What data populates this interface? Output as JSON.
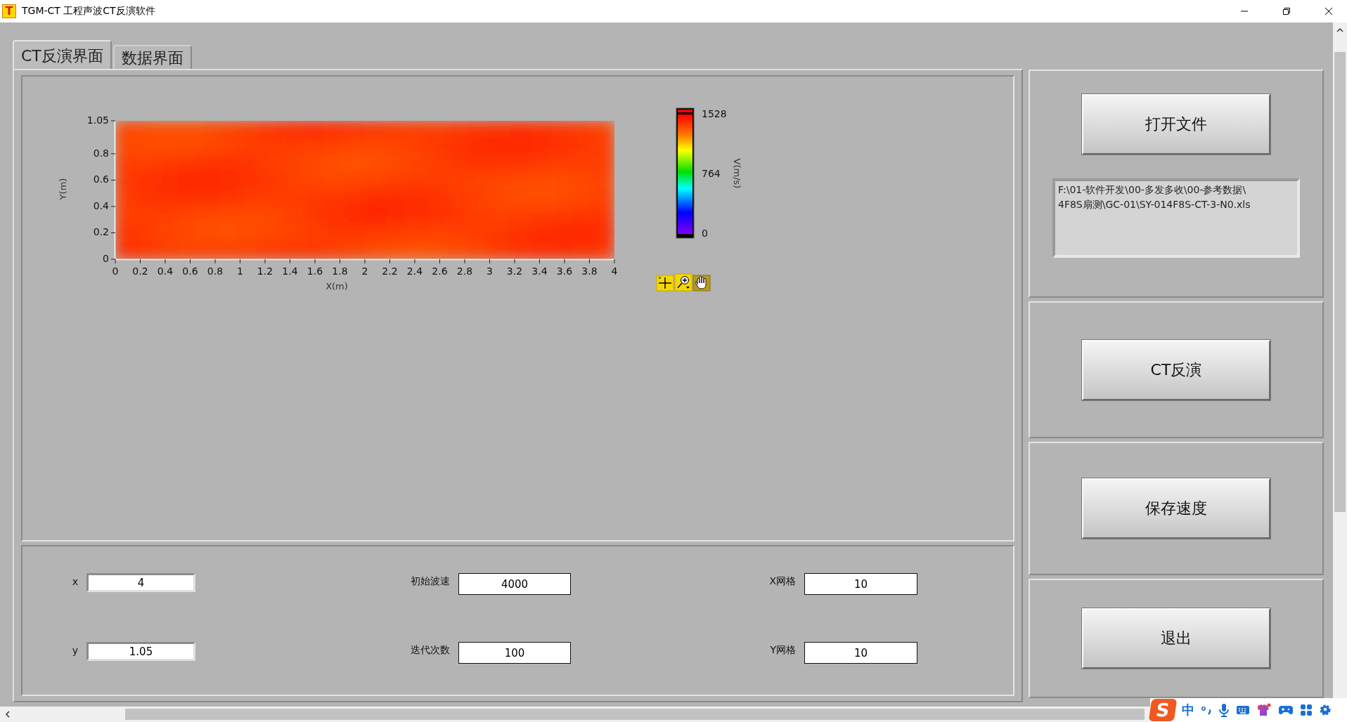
{
  "window": {
    "icon_letter": "T",
    "title": "TGM-CT 工程声波CT反演软件"
  },
  "tabs": [
    {
      "label": "CT反演界面",
      "selected": true
    },
    {
      "label": "数据界面",
      "selected": false
    }
  ],
  "plot": {
    "y_axis_label": "Y(m)",
    "x_axis_label": "X(m)",
    "y_ticks": [
      "1.05",
      "0.8",
      "0.6",
      "0.4",
      "0.2",
      "0"
    ],
    "x_ticks": [
      "0",
      "0.2",
      "0.4",
      "0.6",
      "0.8",
      "1",
      "1.2",
      "1.4",
      "1.6",
      "1.8",
      "2",
      "2.2",
      "2.4",
      "2.6",
      "2.8",
      "3",
      "3.2",
      "3.4",
      "3.6",
      "3.8",
      "4"
    ],
    "colorbar": {
      "title": "V(m/s)",
      "labels": [
        "1528",
        "764",
        "0"
      ]
    }
  },
  "parameters": [
    [
      {
        "kind": "coordinate",
        "label": "x",
        "value": "4"
      },
      {
        "kind": "setting",
        "label": "初始波速",
        "value": "4000"
      },
      {
        "kind": "setting",
        "label": "X网格",
        "value": "10"
      }
    ],
    [
      {
        "kind": "coordinate",
        "label": "y",
        "value": "1.05"
      },
      {
        "kind": "setting",
        "label": "迭代次数",
        "value": "100"
      },
      {
        "kind": "setting",
        "label": "Y网格",
        "value": "10"
      }
    ]
  ],
  "file_path": {
    "lines": [
      "F:\\01-软件开发\\00-多发多收\\00-参考数据\\",
      "4F8S扇测\\GC-01\\SY-014F8S-CT-3-N0.xls"
    ]
  },
  "buttons": [
    "打开文件",
    "CT反演",
    "保存速度",
    "退出"
  ],
  "ime_toolbar": {
    "logo": "S",
    "mode": "中"
  }
}
